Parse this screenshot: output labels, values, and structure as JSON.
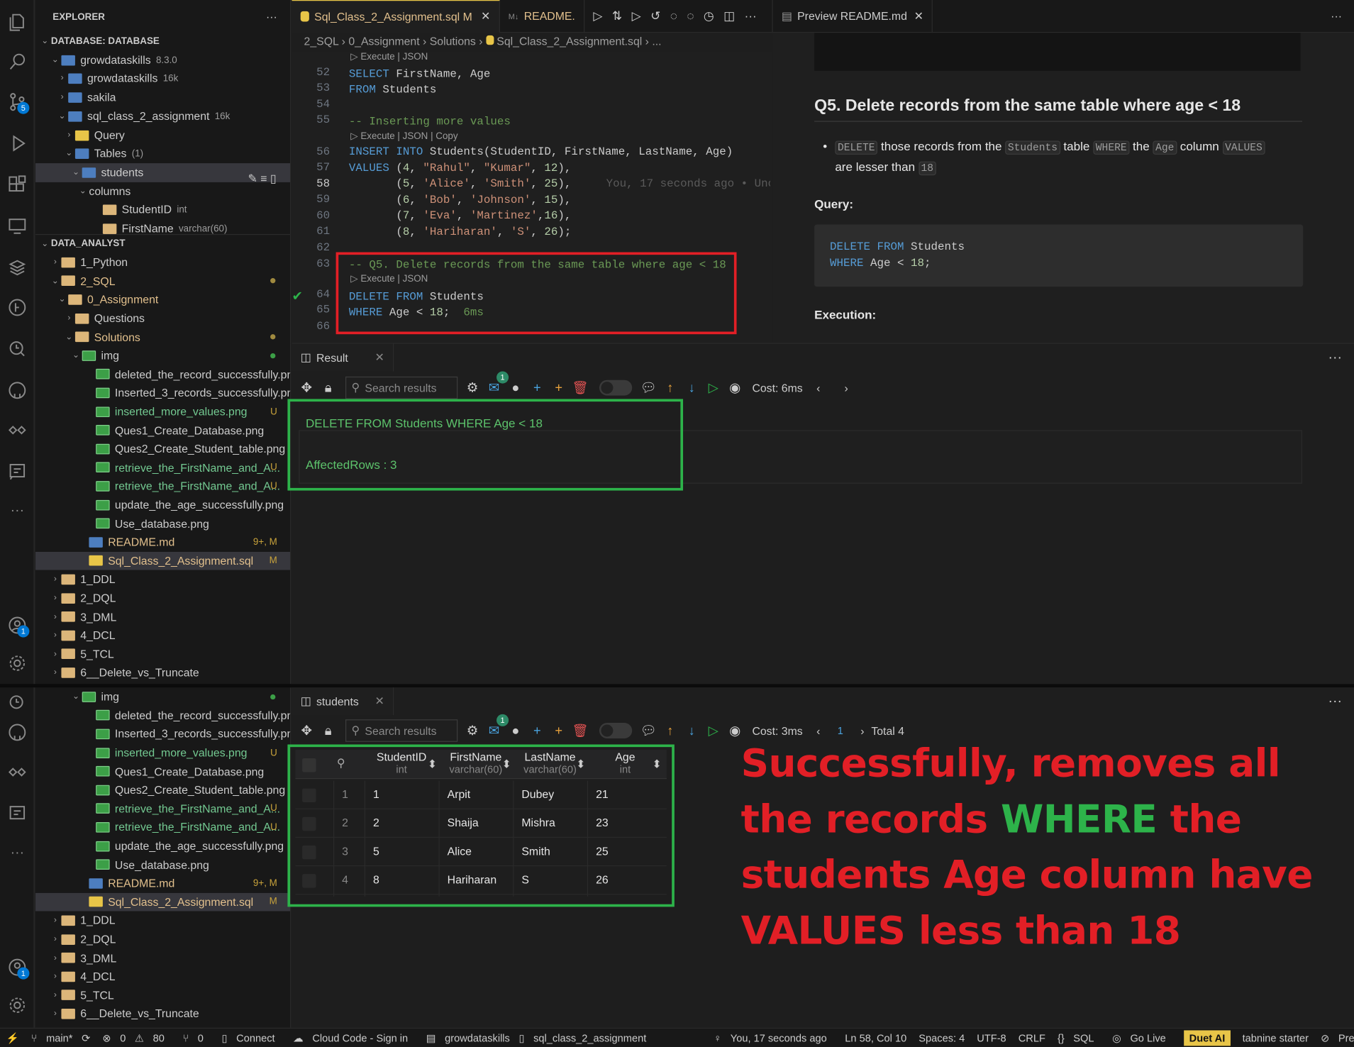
{
  "activity": {
    "icons": [
      "explorer-icon",
      "search-icon",
      "source-control-icon",
      "run-debug-icon",
      "extensions-icon",
      "remote-explorer-icon",
      "database-icon",
      "gitlens-icon",
      "accounts-history-icon",
      "github-icon",
      "duet-icon",
      "notes-icon",
      "more-icon",
      "account-icon",
      "settings-icon"
    ],
    "badge_scm": "5",
    "badge_account": "1"
  },
  "explorer": {
    "title": "EXPLORER",
    "more": "···",
    "db_section": "DATABASE: DATABASE",
    "db_items": [
      {
        "label": "growdataskills",
        "sub": "8.3.0"
      },
      {
        "label": "growdataskills",
        "sub": "16k"
      },
      {
        "label": "sakila",
        "sub": ""
      },
      {
        "label": "sql_class_2_assignment",
        "sub": "16k"
      },
      {
        "label": "Query",
        "sub": ""
      },
      {
        "label": "Tables",
        "sub": "(1)"
      },
      {
        "label": "students",
        "sub": ""
      },
      {
        "label": "columns",
        "sub": ""
      },
      {
        "label": "StudentID",
        "sub": "int"
      },
      {
        "label": "FirstName",
        "sub": "varchar(60)"
      }
    ],
    "da_section": "DATA_ANALYST",
    "da_items": [
      {
        "label": "1_Python",
        "st": ""
      },
      {
        "label": "2_SQL",
        "st": ""
      },
      {
        "label": "0_Assignment",
        "st": ""
      },
      {
        "label": "Questions",
        "st": ""
      },
      {
        "label": "Solutions",
        "st": ""
      },
      {
        "label": "img",
        "st": ""
      },
      {
        "label": "deleted_the_record_successfully.png",
        "st": ""
      },
      {
        "label": "Inserted_3_records_successfully.png",
        "st": ""
      },
      {
        "label": "inserted_more_values.png",
        "st": "U"
      },
      {
        "label": "Ques1_Create_Database.png",
        "st": ""
      },
      {
        "label": "Ques2_Create_Student_table.png",
        "st": ""
      },
      {
        "label": "retrieve_the_FirstName_and_A...",
        "st": "U"
      },
      {
        "label": "retrieve_the_FirstName_and_A...",
        "st": "U"
      },
      {
        "label": "update_the_age_successfully.png",
        "st": ""
      },
      {
        "label": "Use_database.png",
        "st": ""
      },
      {
        "label": "README.md",
        "st": "9+, M"
      },
      {
        "label": "Sql_Class_2_Assignment.sql",
        "st": "M"
      },
      {
        "label": "1_DDL",
        "st": ""
      },
      {
        "label": "2_DQL",
        "st": ""
      },
      {
        "label": "3_DML",
        "st": ""
      },
      {
        "label": "4_DCL",
        "st": ""
      },
      {
        "label": "5_TCL",
        "st": ""
      },
      {
        "label": "6__Delete_vs_Truncate",
        "st": ""
      }
    ]
  },
  "editor": {
    "tab1": "Sql_Class_2_Assignment.sql",
    "tab1_mark": "M",
    "tab2": "README.",
    "tab3": "Preview README.md",
    "breadcrumb": [
      "2_SQL",
      "0_Assignment",
      "Solutions",
      "Sql_Class_2_Assignment.sql",
      "..."
    ],
    "lens_execute_json": "Execute | JSON",
    "lens_execute_json_copy": "Execute | JSON | Copy",
    "line_numbers": [
      "52",
      "53",
      "54",
      "55",
      "56",
      "57",
      "58",
      "59",
      "60",
      "61",
      "62",
      "63",
      "64",
      "65",
      "66"
    ],
    "blame": "You, 17 seconds ago • Unc",
    "timing": "6ms"
  },
  "preview": {
    "heading": "Q5. Delete records from the same table where age < 18",
    "bullet": {
      "w1": "DELETE",
      "t1": "those records from the",
      "w2": "Students",
      "t2": "table",
      "w3": "WHERE",
      "t3": "the",
      "w4": "Age",
      "t4": "column",
      "w5": "VALUES",
      "t5": "are lesser than",
      "w6": "18"
    },
    "query_label": "Query:",
    "code1_kw": "DELETE FROM",
    "code1_id": "Students",
    "code2_kw": "WHERE",
    "code2_rest": "Age <",
    "code2_num": "18",
    "code2_end": ";",
    "exec_label": "Execution:"
  },
  "result_panel": {
    "tab": "Result",
    "search_placeholder": "Search results",
    "mail_badge": "1",
    "cost": "Cost: 6ms",
    "query_text": "DELETE FROM Students WHERE Age < 18",
    "affected": "AffectedRows : 3"
  },
  "students_panel": {
    "tab": "students",
    "search_placeholder": "Search results",
    "mail_badge": "1",
    "cost": "Cost: 3ms",
    "page": "1",
    "total": "Total 4",
    "columns": [
      {
        "name": "StudentID",
        "type": "int"
      },
      {
        "name": "FirstName",
        "type": "varchar(60)"
      },
      {
        "name": "LastName",
        "type": "varchar(60)"
      },
      {
        "name": "Age",
        "type": "int"
      }
    ],
    "rows": [
      [
        "1",
        "1",
        "Arpit",
        "Dubey",
        "21"
      ],
      [
        "2",
        "2",
        "Shaija",
        "Mishra",
        "23"
      ],
      [
        "3",
        "5",
        "Alice",
        "Smith",
        "25"
      ],
      [
        "4",
        "8",
        "Hariharan",
        "S",
        "26"
      ]
    ]
  },
  "annotation": {
    "part1": "Successfully, removes all the records",
    "highlight": "WHERE",
    "part2": "the students Age column have VALUES less than 18"
  },
  "statusbar": {
    "branch": "main*",
    "errors": "0",
    "warnings": "80",
    "ports": "0",
    "connect": "Connect",
    "cloud": "Cloud Code - Sign in",
    "db": "growdataskills",
    "schema": "sql_class_2_assignment",
    "blame": "You, 17 seconds ago",
    "pos": "Ln 58, Col 10",
    "spaces": "Spaces: 4",
    "enc": "UTF-8",
    "eol": "CRLF",
    "lang": "SQL",
    "golive": "Go Live",
    "duet": "Duet AI",
    "tabnine": "tabnine starter",
    "prettier": "Prettier"
  },
  "colors": {
    "accent_yellow": "#e8c548",
    "red_box": "#e21f26",
    "green_box": "#2db34a",
    "annotation_red": "#e21f26",
    "annotation_green": "#2db34a"
  }
}
